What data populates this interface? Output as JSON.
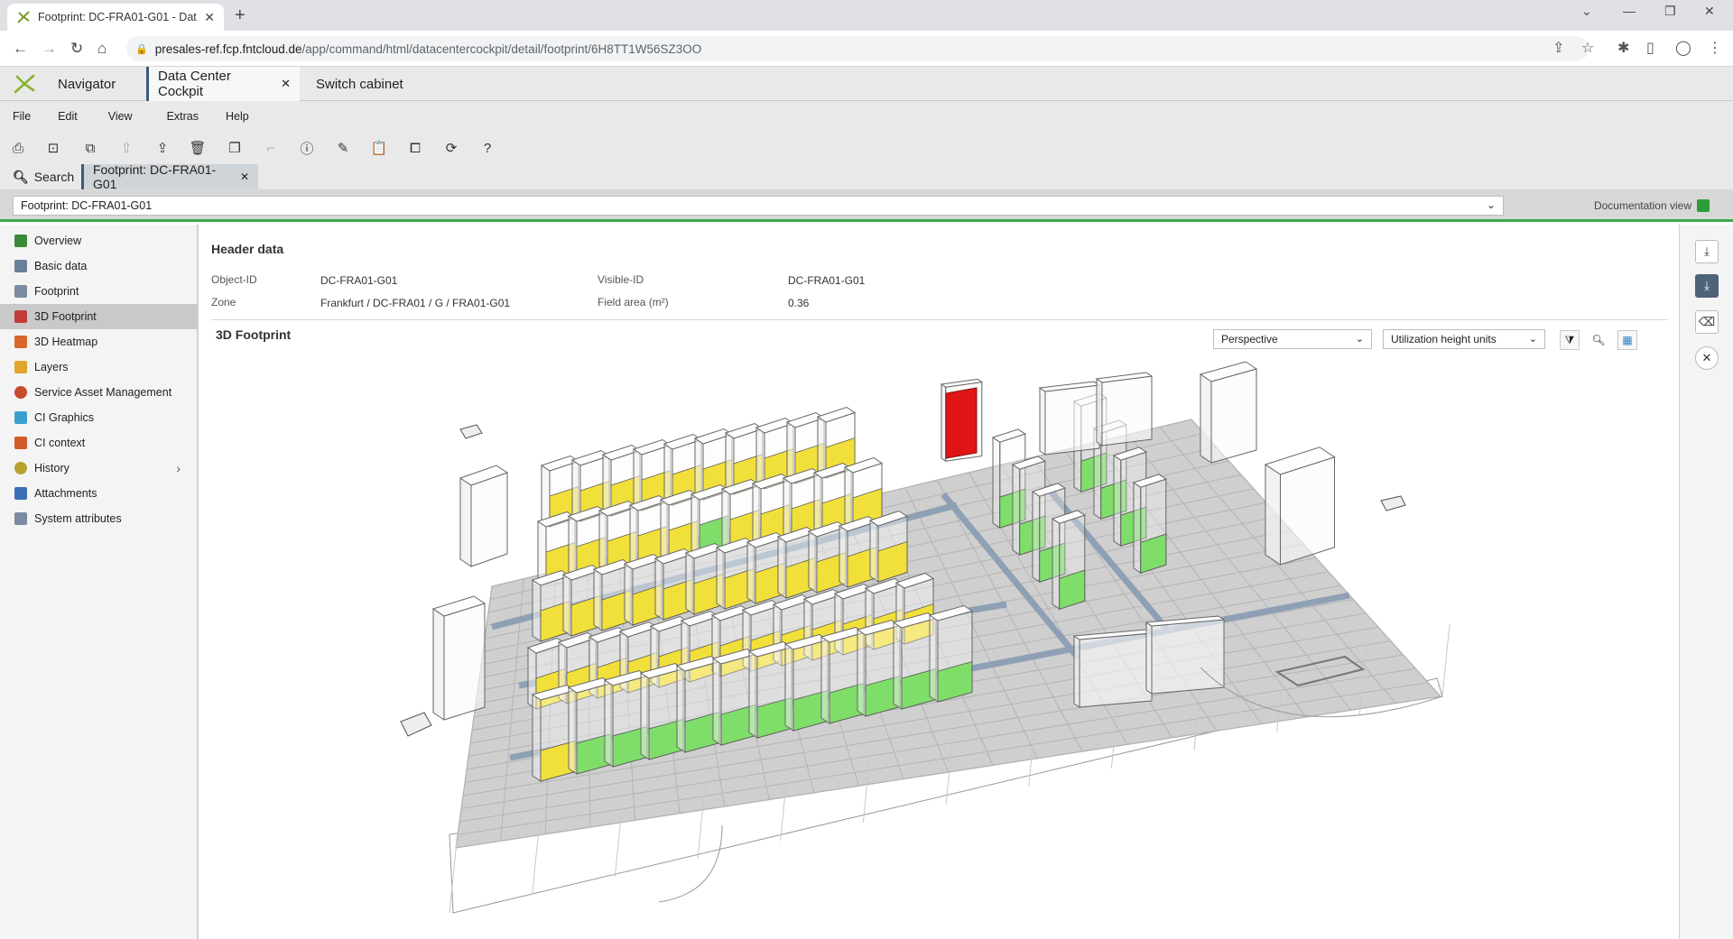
{
  "browser": {
    "tab_title": "Footprint: DC-FRA01-G01 - Data",
    "url_host": "presales-ref.fcp.fntcloud.de",
    "url_path": "/app/command/html/datacentercockpit/detail/footprint/6H8TT1W56SZ3OO"
  },
  "app_tabs": {
    "navigator": "Navigator",
    "cockpit": "Data Center Cockpit",
    "switch": "Switch cabinet"
  },
  "menu": {
    "file": "File",
    "edit": "Edit",
    "view": "View",
    "extras": "Extras",
    "help": "Help"
  },
  "inner_tabs": {
    "search": "Search",
    "footprint": "Footprint: DC-FRA01-G01"
  },
  "selector": {
    "value": "Footprint: DC-FRA01-G01",
    "documentation_view": "Documentation view"
  },
  "nav": [
    {
      "label": "Overview",
      "color": "#3a8a3a"
    },
    {
      "label": "Basic data",
      "color": "#6b7f99"
    },
    {
      "label": "Footprint",
      "color": "#7a8ca0"
    },
    {
      "label": "3D Footprint",
      "color": "#c23b3b"
    },
    {
      "label": "3D Heatmap",
      "color": "#d9662b"
    },
    {
      "label": "Layers",
      "color": "#e0a52b"
    },
    {
      "label": "Service Asset Management",
      "color": "#c84a2f"
    },
    {
      "label": "CI Graphics",
      "color": "#3d9fd0"
    },
    {
      "label": "CI context",
      "color": "#d35a2a"
    },
    {
      "label": "History",
      "color": "#b7a230"
    },
    {
      "label": "Attachments",
      "color": "#3b6fb5"
    },
    {
      "label": "System attributes",
      "color": "#7a8ca0"
    }
  ],
  "header": {
    "title": "Header data",
    "object_id_label": "Object-ID",
    "object_id": "DC-FRA01-G01",
    "zone_label": "Zone",
    "zone": "Frankfurt / DC-FRA01 / G / FRA01-G01",
    "visible_id_label": "Visible-ID",
    "visible_id": "DC-FRA01-G01",
    "field_area_label": "Field area (m²)",
    "field_area": "0.36"
  },
  "footprint": {
    "title": "3D Footprint",
    "projection": "Perspective",
    "coloring": "Utilization height units"
  },
  "colors": {
    "accent_green": "#3ea84a",
    "rack_yellow": "#f2e03a",
    "rack_green": "#7fde6a",
    "rack_red": "#e01414"
  }
}
